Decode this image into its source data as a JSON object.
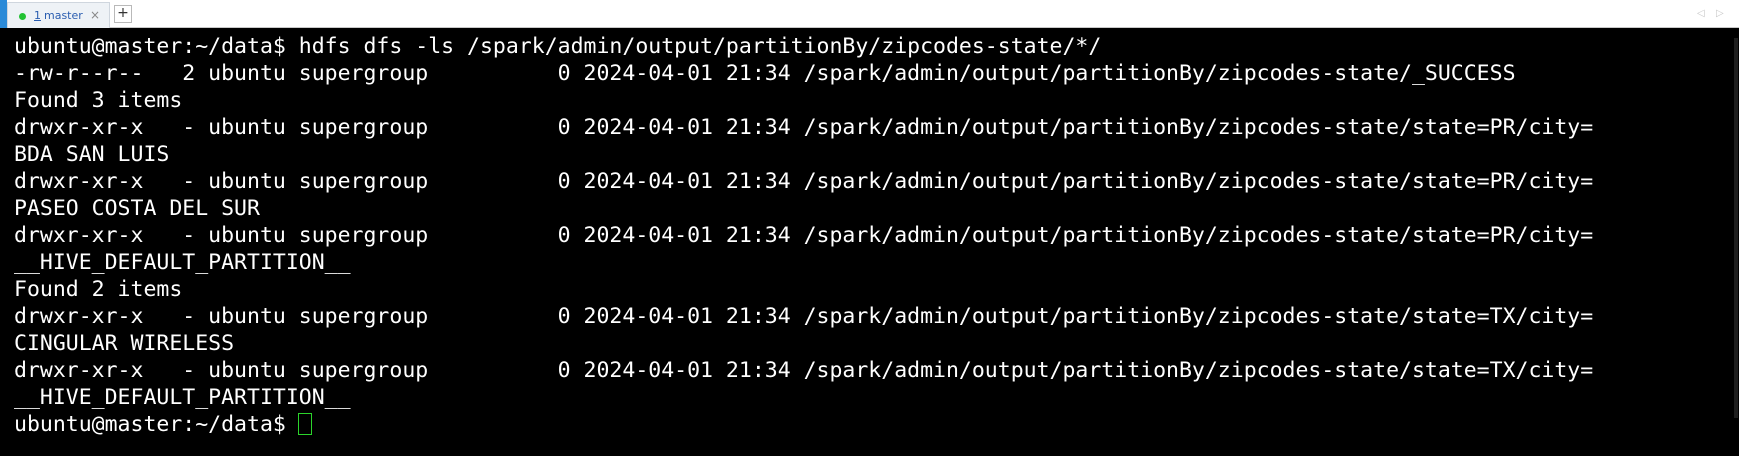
{
  "tabbar": {
    "tab": {
      "number": "1",
      "title": "master",
      "close_glyph": "×"
    },
    "new_tab_glyph": "+",
    "scroll_left_glyph": "◁",
    "scroll_right_glyph": "▷",
    "colors": {
      "accent": "#2a8ad8",
      "tab_text": "#2a5db0",
      "status_dot": "#22c233"
    }
  },
  "terminal": {
    "lines": [
      "ubuntu@master:~/data$ hdfs dfs -ls /spark/admin/output/partitionBy/zipcodes-state/*/",
      "-rw-r--r--   2 ubuntu supergroup          0 2024-04-01 21:34 /spark/admin/output/partitionBy/zipcodes-state/_SUCCESS",
      "Found 3 items",
      "drwxr-xr-x   - ubuntu supergroup          0 2024-04-01 21:34 /spark/admin/output/partitionBy/zipcodes-state/state=PR/city=",
      "BDA SAN LUIS",
      "drwxr-xr-x   - ubuntu supergroup          0 2024-04-01 21:34 /spark/admin/output/partitionBy/zipcodes-state/state=PR/city=",
      "PASEO COSTA DEL SUR",
      "drwxr-xr-x   - ubuntu supergroup          0 2024-04-01 21:34 /spark/admin/output/partitionBy/zipcodes-state/state=PR/city=",
      "__HIVE_DEFAULT_PARTITION__",
      "Found 2 items",
      "drwxr-xr-x   - ubuntu supergroup          0 2024-04-01 21:34 /spark/admin/output/partitionBy/zipcodes-state/state=TX/city=",
      "CINGULAR WIRELESS",
      "drwxr-xr-x   - ubuntu supergroup          0 2024-04-01 21:34 /spark/admin/output/partitionBy/zipcodes-state/state=TX/city=",
      "__HIVE_DEFAULT_PARTITION__"
    ],
    "prompt": "ubuntu@master:~/data$",
    "colors": {
      "background": "#000000",
      "foreground": "#ffffff",
      "cursor": "#2bd42b"
    }
  }
}
